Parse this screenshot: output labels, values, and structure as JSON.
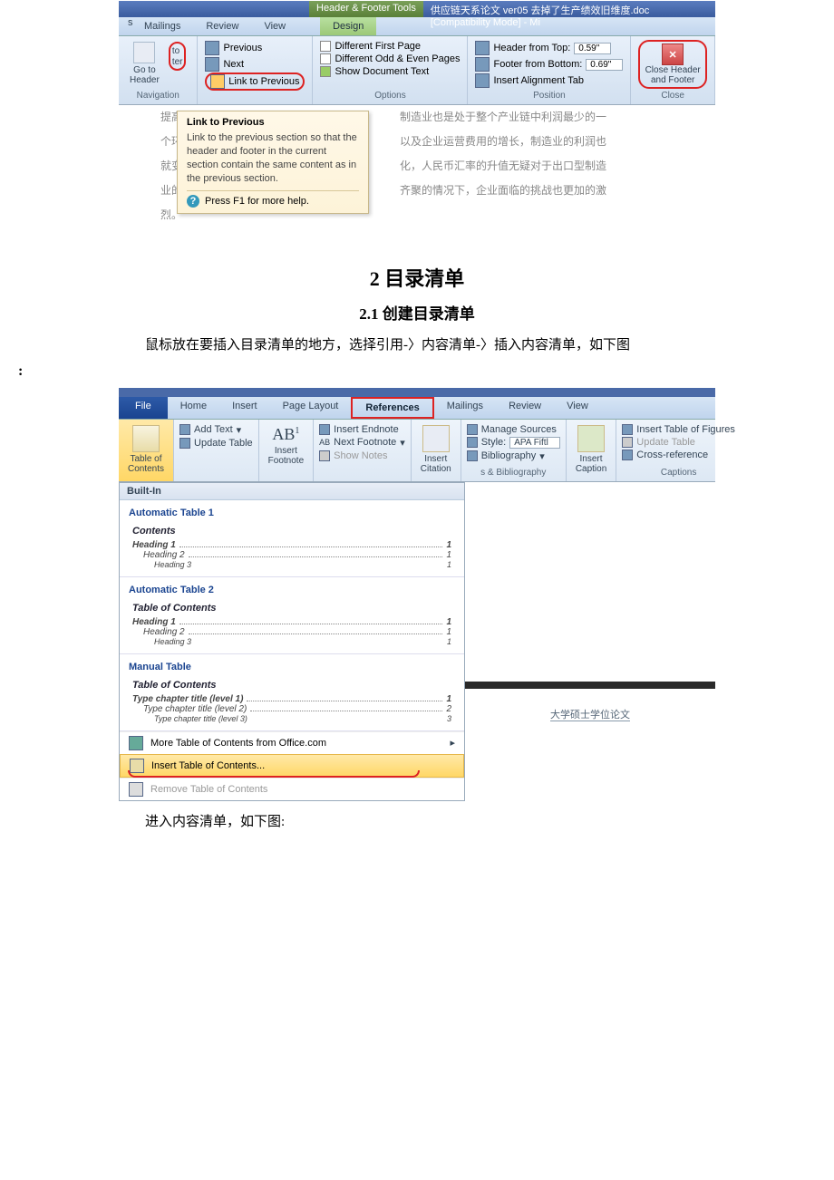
{
  "scr1": {
    "hftools": "Header & Footer Tools",
    "docname": "供应链天系论文 ver05 去掉了生产绩效旧维度.doc [Compatibility Mode] - Mi",
    "tabs": {
      "mailings": "Mailings",
      "review": "Review",
      "view": "View",
      "design": "Design"
    },
    "nav": {
      "goto_header": "Go to\nHeader",
      "goto_footer": "to\nter",
      "prev": "Previous",
      "next": "Next",
      "link": "Link to Previous",
      "label": "Navigation"
    },
    "options": {
      "dfp": "Different First Page",
      "doe": "Different Odd & Even Pages",
      "sdt": "Show Document Text",
      "label": "Options"
    },
    "position": {
      "hft": "Header from Top:",
      "hft_val": "0.59\"",
      "ffb": "Footer from Bottom:",
      "ffb_val": "0.69\"",
      "iat": "Insert Alignment Tab",
      "label": "Position"
    },
    "close": {
      "label": "Close Header\nand Footer",
      "section": "Close"
    },
    "tooltip": {
      "title": "Link to Previous",
      "body": "Link to the previous section so that the header and footer in the current section contain the same content as in the previous section.",
      "help": "Press F1 for more help."
    },
    "doc": {
      "l1": "提高",
      "r1": "制造业也是处于整个产业链中利润最少的一",
      "l2": "个环",
      "r2": "以及企业运营费用的增长，制造业的利润也",
      "l3": "就变",
      "r3": "化，人民币汇率的升值无疑对于出口型制造",
      "l4": "业的",
      "r4": "齐聚的情况下，企业面临的挑战也更加的激",
      "l5": "烈。"
    }
  },
  "headings": {
    "h2": "2 目录清单",
    "h21": "2.1 创建目录清单"
  },
  "para1": "鼠标放在要插入目录清单的地方，选择引用-〉内容清单-〉插入内容清单，如下图",
  "colon": ":",
  "scr2": {
    "tabs": {
      "file": "File",
      "home": "Home",
      "insert": "Insert",
      "pagelayout": "Page Layout",
      "references": "References",
      "mailings": "Mailings",
      "review": "Review",
      "view": "View"
    },
    "toc": {
      "btn": "Table of\nContents",
      "add": "Add Text",
      "update": "Update Table",
      "builtin": "Built-In",
      "auto1": "Automatic Table 1",
      "auto2": "Automatic Table 2",
      "manual": "Manual Table",
      "contents": "Contents",
      "toc_title": "Table of Contents",
      "h1": "Heading 1",
      "h2": "Heading 2",
      "h3": "Heading 3",
      "p1": "1",
      "p2": "1",
      "p3": "1",
      "m1": "Type chapter title (level 1)",
      "m2": "Type chapter title (level 2)",
      "m3": "Type chapter title (level 3)",
      "more": "More Table of Contents from Office.com",
      "insert": "Insert Table of Contents...",
      "remove": "Remove Table of Contents"
    },
    "footnotes": {
      "btn": "Insert\nFootnote",
      "ab": "AB",
      "endnote": "Insert Endnote",
      "next": "Next Footnote",
      "show": "Show Notes"
    },
    "citations": {
      "btn": "Insert\nCitation",
      "manage": "Manage Sources",
      "style": "Style:",
      "style_val": "APA Fiftl",
      "bib": "Bibliography",
      "label": "s & Bibliography"
    },
    "captions": {
      "btn": "Insert\nCaption",
      "itof": "Insert Table of Figures",
      "update": "Update Table",
      "cross": "Cross-reference",
      "label": "Captions"
    },
    "thumb": "大学硕士学位论文"
  },
  "para2": "进入内容清单，如下图:"
}
